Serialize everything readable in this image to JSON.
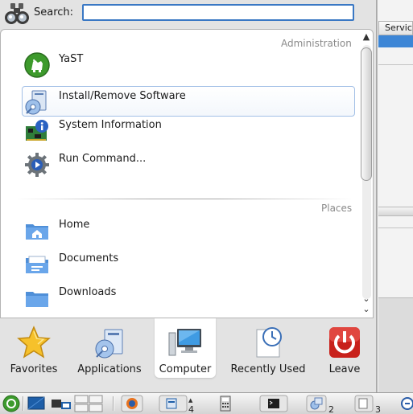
{
  "search": {
    "label": "Search:",
    "value": "",
    "placeholder": ""
  },
  "sections": {
    "administration": "Administration",
    "places": "Places"
  },
  "admin_items": [
    {
      "label": "YaST",
      "icon": "yast-icon"
    },
    {
      "label": "Install/Remove Software",
      "icon": "install-software-icon"
    },
    {
      "label": "System Information",
      "icon": "system-information-icon"
    },
    {
      "label": "Run Command...",
      "icon": "run-command-icon"
    }
  ],
  "place_items": [
    {
      "label": "Home",
      "icon": "home-folder-icon"
    },
    {
      "label": "Documents",
      "icon": "documents-folder-icon"
    },
    {
      "label": "Downloads",
      "icon": "downloads-folder-icon"
    }
  ],
  "tabs": [
    {
      "label": "Favorites",
      "icon": "star-icon"
    },
    {
      "label": "Applications",
      "icon": "applications-icon"
    },
    {
      "label": "Computer",
      "icon": "computer-icon",
      "active": true
    },
    {
      "label": "Recently Used",
      "icon": "recently-used-icon"
    },
    {
      "label": "Leave",
      "icon": "power-icon"
    }
  ],
  "background_window": {
    "column_header": "Service"
  },
  "taskbar": {
    "desktop_count_1": "4",
    "desktop_count_2": "2",
    "desktop_count_3": "3"
  },
  "colors": {
    "accent": "#3a78c4",
    "selection": "#3d86d6",
    "leave_red": "#c8211b"
  }
}
